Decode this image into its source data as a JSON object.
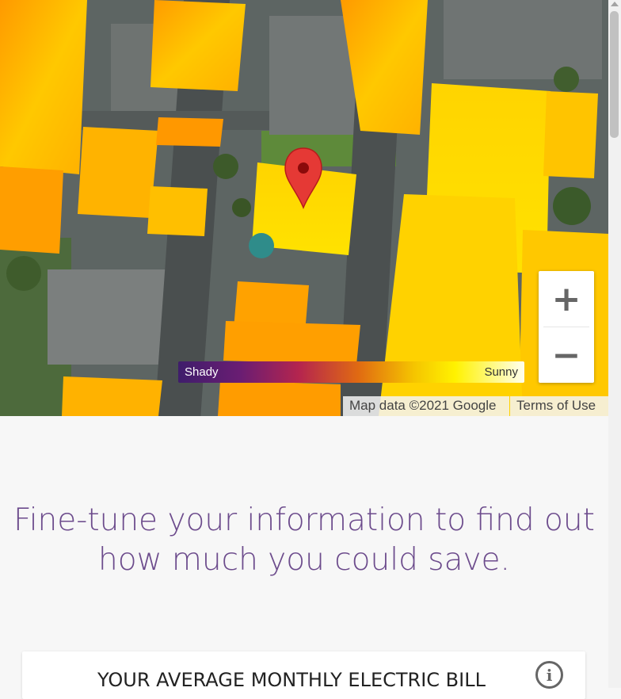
{
  "map": {
    "legend": {
      "low_label": "Shady",
      "high_label": "Sunny"
    },
    "zoom": {
      "in_label": "+",
      "out_label": "−"
    },
    "attribution": {
      "data_label": "Map data ©2021 Google",
      "terms_label": "Terms of Use"
    },
    "marker_color": "#e53935"
  },
  "main": {
    "headline_line1": "Fine-tune your information to find out",
    "headline_line2": "how much you could save.",
    "bill_card": {
      "title": "YOUR AVERAGE MONTHLY ELECTRIC BILL",
      "info_icon": "i"
    }
  },
  "colors": {
    "headline": "#6c4b8c",
    "roof_hot": "#ffd200",
    "roof_warm": "#ffa400"
  }
}
